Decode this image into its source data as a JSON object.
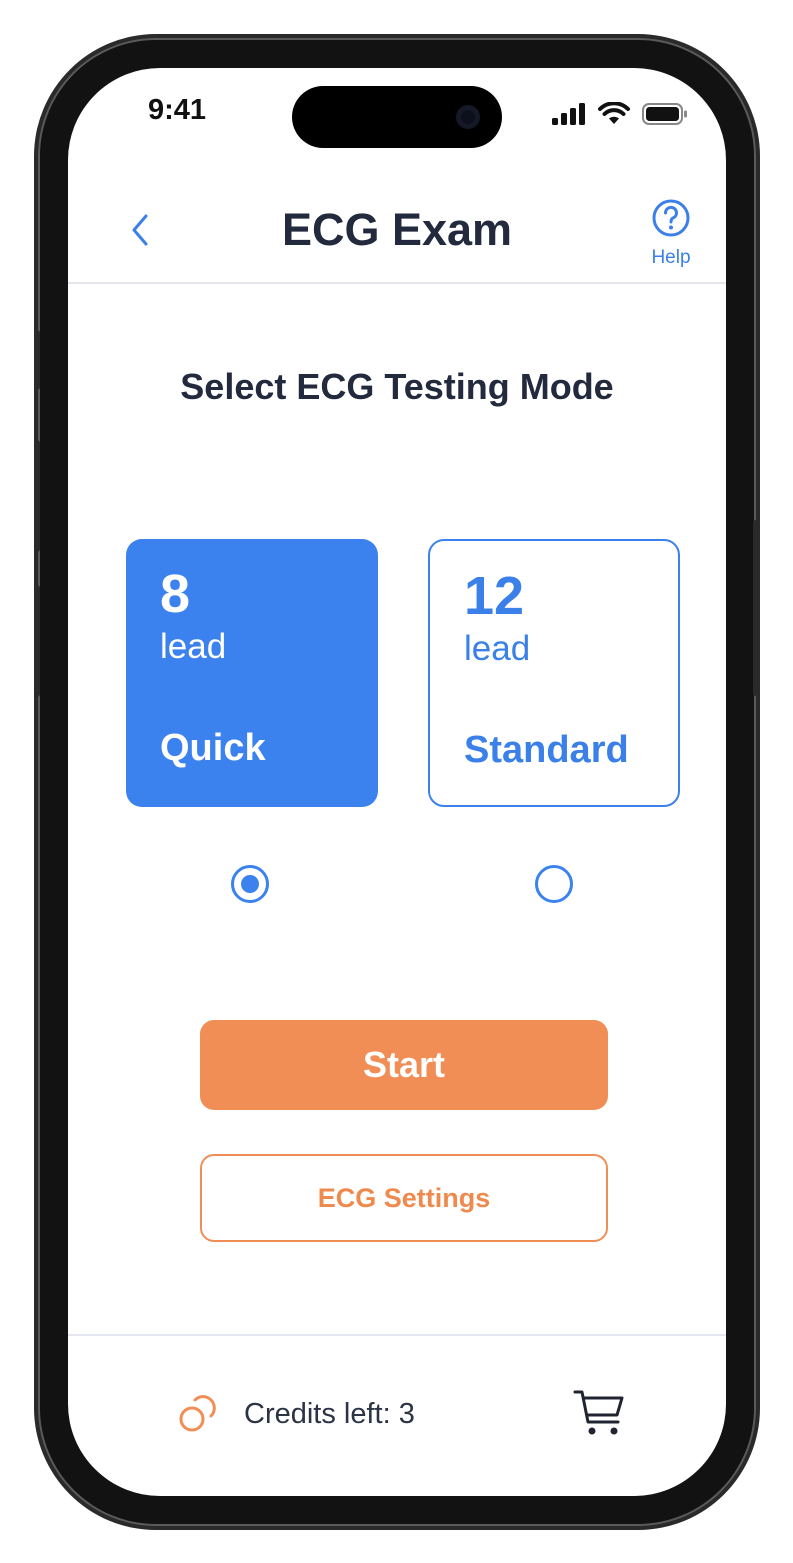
{
  "status_bar": {
    "time": "9:41"
  },
  "header": {
    "title": "ECG Exam",
    "help_label": "Help"
  },
  "main": {
    "subtitle": "Select ECG Testing Mode",
    "modes": [
      {
        "number": "8",
        "unit": "lead",
        "name": "Quick",
        "selected": true
      },
      {
        "number": "12",
        "unit": "lead",
        "name": "Standard",
        "selected": false
      }
    ],
    "start_label": "Start",
    "settings_label": "ECG Settings"
  },
  "footer": {
    "credits_text": "Credits left: 3"
  },
  "colors": {
    "primary_blue": "#3c82ee",
    "accent_orange": "#f08e55",
    "title_text": "#232a3d"
  },
  "icons": {
    "back": "chevron-left-icon",
    "help": "question-circle-icon",
    "credits": "coins-icon",
    "cart": "shopping-cart-icon",
    "signal": "cellular-signal-icon",
    "wifi": "wifi-icon",
    "battery": "battery-icon"
  }
}
